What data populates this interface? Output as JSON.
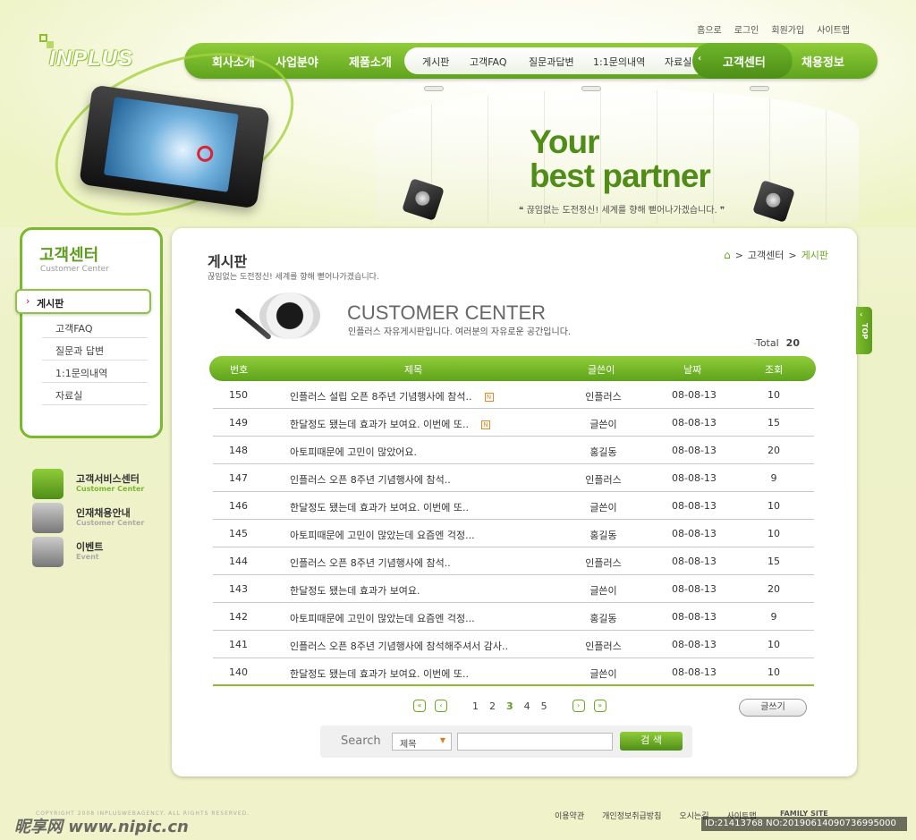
{
  "util": [
    "홈으로",
    "로그인",
    "회원가입",
    "사이트맵"
  ],
  "logo": "INPLUS",
  "gnb": {
    "items": [
      "회사소개",
      "사업분야",
      "제품소개",
      "고객센터",
      "채용정보"
    ],
    "sub": [
      "게시판",
      "고객FAQ",
      "질문과답변",
      "1:1문의내역",
      "자료실"
    ]
  },
  "hero": {
    "line1": "Your",
    "line2": "best partner",
    "quote": "끊임없는 도전정신! 세계를 향해 뻗어나가겠습니다."
  },
  "lnb": {
    "title": "고객센터",
    "title_en": "Customer Center",
    "items": [
      "게시판",
      "고객FAQ",
      "질문과 답변",
      "1:1문의내역",
      "자료실"
    ]
  },
  "quick": [
    {
      "ko": "고객서비스센터",
      "en": "Customer Center",
      "color": "#6aa820"
    },
    {
      "ko": "인재채용안내",
      "en": "Customer Center",
      "color": "#aaaaaa"
    },
    {
      "ko": "이벤트",
      "en": "Event",
      "color": "#aaaaaa"
    }
  ],
  "page": {
    "title": "게시판",
    "desc": "끊임없는 도전정신! 세계를 향해 뻗어나가겠습니다.",
    "breadcrumb": [
      "고객센터",
      "게시판"
    ],
    "cc_title": "CUSTOMER CENTER",
    "cc_desc": "인플러스 자유게시판입니다. 여러분의 자유로운 공간입니다.",
    "total_label": "Total",
    "total": "20"
  },
  "table": {
    "headers": [
      "번호",
      "제목",
      "글쓴이",
      "날짜",
      "조회"
    ],
    "rows": [
      {
        "no": "150",
        "subject": "인플러스 설립 오픈 8주년 기념행사에 참석..",
        "new": "N",
        "writer": "인플러스",
        "date": "08-08-13",
        "views": "10"
      },
      {
        "no": "149",
        "subject": "한달정도 됐는데 효과가 보여요. 이번에 또..",
        "new": "N",
        "writer": "글쓴이",
        "date": "08-08-13",
        "views": "15"
      },
      {
        "no": "148",
        "subject": "아토피때문에 고민이 많았어요.",
        "new": "",
        "writer": "홍길동",
        "date": "08-08-13",
        "views": "20"
      },
      {
        "no": "147",
        "subject": "인플러스 오픈 8주년 기념행사에 참석..",
        "new": "",
        "writer": "인플러스",
        "date": "08-08-13",
        "views": "9"
      },
      {
        "no": "146",
        "subject": "한달정도 됐는데 효과가 보여요. 이번에 또..",
        "new": "",
        "writer": "글쓴이",
        "date": "08-08-13",
        "views": "10"
      },
      {
        "no": "145",
        "subject": "아토피때문에 고민이 많았는데 요즘엔 걱정...",
        "new": "",
        "writer": "홍길동",
        "date": "08-08-13",
        "views": "10"
      },
      {
        "no": "144",
        "subject": "인플러스 오픈 8주년 기념행사에 참석..",
        "new": "",
        "writer": "인플러스",
        "date": "08-08-13",
        "views": "15"
      },
      {
        "no": "143",
        "subject": "한달정도 됐는데 효과가 보여요.",
        "new": "",
        "writer": "글쓴이",
        "date": "08-08-13",
        "views": "20"
      },
      {
        "no": "142",
        "subject": "아토피때문에 고민이 많았는데 요즘엔 걱정...",
        "new": "",
        "writer": "홍길동",
        "date": "08-08-13",
        "views": "9"
      },
      {
        "no": "141",
        "subject": "인플러스 오픈 8주년 기념행사에 참석해주셔서 감사..",
        "new": "",
        "writer": "인플러스",
        "date": "08-08-13",
        "views": "10"
      },
      {
        "no": "140",
        "subject": "한달정도 됐는데 효과가 보여요. 이번에 또..",
        "new": "",
        "writer": "글쓴이",
        "date": "08-08-13",
        "views": "10"
      }
    ]
  },
  "pager": {
    "pages": [
      "1",
      "2",
      "3",
      "4",
      "5"
    ],
    "current": "3"
  },
  "write_label": "글쓰기",
  "search": {
    "label": "Search",
    "field": "제목",
    "button": "검 색"
  },
  "top_label": "TOP",
  "footer": {
    "copyright": "COPYRIGHT 2008 INPLUSWEBAGENCY. ALL RIGHTS RESERVED.",
    "links": [
      "이용약관",
      "개인정보취급방침",
      "오시는길",
      "사이트맵"
    ],
    "family": "FAMILY SITE"
  },
  "watermark": {
    "left": "昵享网 www.nipic.cn",
    "right": "ID:21413768 NO:20190614090736995000"
  },
  "colors": {
    "accent": "#6aa820",
    "new_badge": "#e08a2a"
  }
}
